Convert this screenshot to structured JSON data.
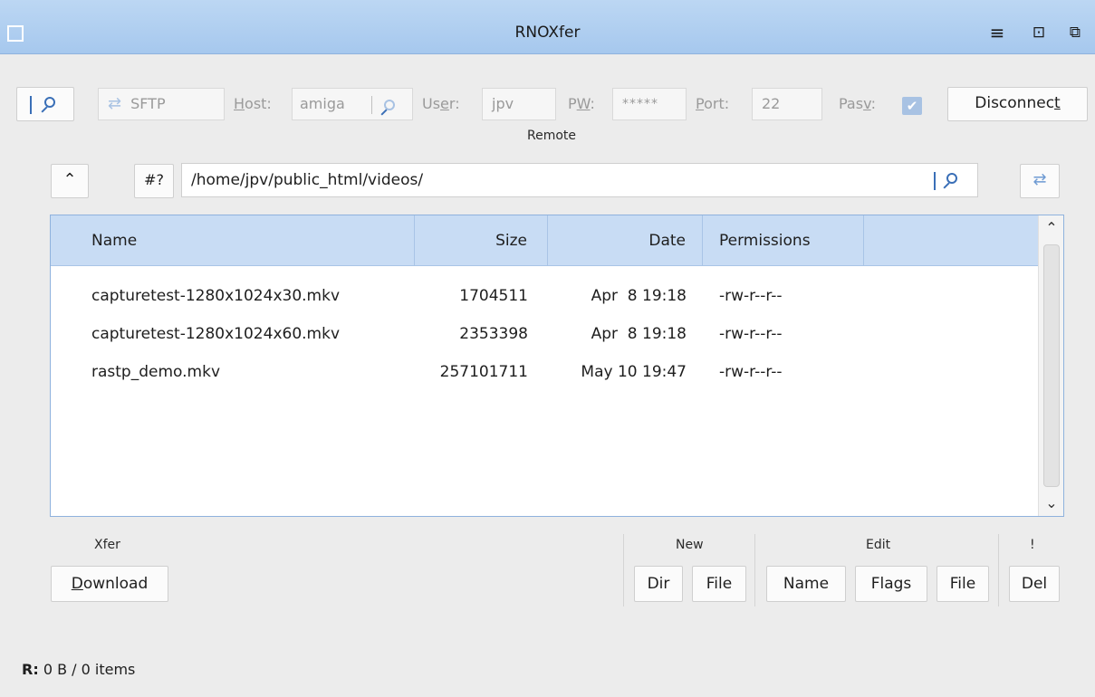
{
  "window": {
    "title": "RNOXfer"
  },
  "toolbar": {
    "protocol": "SFTP",
    "host_label": "Host:",
    "host_value": "amiga",
    "user_label": "User:",
    "user_value": "jpv",
    "pw_label": "PW:",
    "pw_value": "*****",
    "port_label": "Port:",
    "port_value": "22",
    "pasv_label": "Pasv:",
    "pasv_checked": true,
    "disconnect_label": "Disconnect"
  },
  "remote": {
    "section_label": "Remote",
    "hash_button": "#?",
    "path": "/home/jpv/public_html/videos/"
  },
  "table": {
    "columns": [
      "Name",
      "Size",
      "Date",
      "Permissions"
    ],
    "rows": [
      {
        "name": "capturetest-1280x1024x30.mkv",
        "size": "1704511",
        "date": "Apr  8 19:18",
        "perms": "-rw-r--r--"
      },
      {
        "name": "capturetest-1280x1024x60.mkv",
        "size": "2353398",
        "date": "Apr  8 19:18",
        "perms": "-rw-r--r--"
      },
      {
        "name": "rastp_demo.mkv",
        "size": "257101711",
        "date": "May 10 19:47",
        "perms": "-rw-r--r--"
      }
    ]
  },
  "actions": {
    "xfer_label": "Xfer",
    "download": "Download",
    "new_label": "New",
    "new_dir": "Dir",
    "new_file": "File",
    "edit_label": "Edit",
    "edit_name": "Name",
    "edit_flags": "Flags",
    "edit_file": "File",
    "danger_label": "!",
    "delete": "Del"
  },
  "status": {
    "prefix": "R:",
    "text": "0 B / 0 items"
  }
}
